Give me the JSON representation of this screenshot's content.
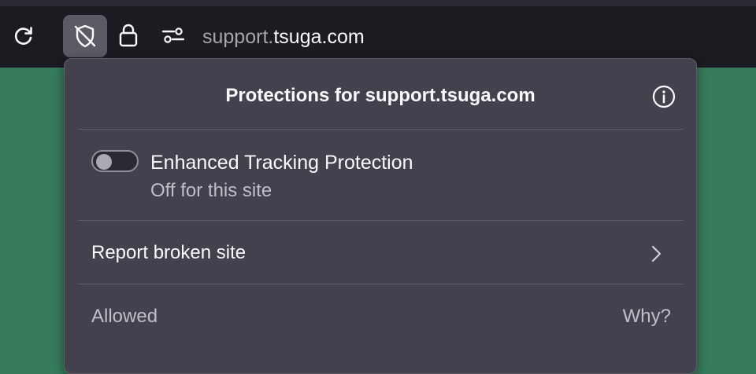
{
  "colors": {
    "page_background": "#367b5c",
    "toolbar_background": "#1c1b22",
    "panel_background": "#42414d",
    "primary_text": "#fbfbfe",
    "secondary_text": "#bfbfc9"
  },
  "toolbar": {
    "reload_icon": "reload-icon",
    "shield_icon": "shield-off-icon",
    "lock_icon": "lock-icon",
    "permissions_icon": "permissions-icon"
  },
  "urlbar": {
    "subdomain": "support.",
    "domain": "tsuga.com"
  },
  "protections_panel": {
    "title": "Protections for support.tsuga.com",
    "info_icon": "info-icon",
    "tracking_protection": {
      "label": "Enhanced Tracking Protection",
      "status": "Off for this site",
      "enabled": false
    },
    "report_broken_site": {
      "label": "Report broken site",
      "icon": "chevron-right-icon"
    },
    "allowed": {
      "label": "Allowed",
      "why_link": "Why?"
    }
  }
}
